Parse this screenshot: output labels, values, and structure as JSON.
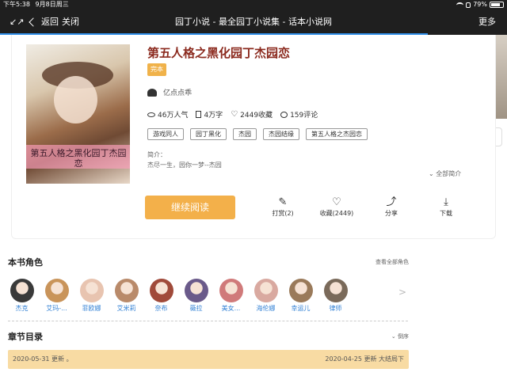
{
  "status_bar": {
    "time": "下午5:38",
    "date": "9月8日周三",
    "battery_percent": "79%",
    "battery_level": 0.79
  },
  "nav": {
    "back_label": "返回",
    "close_label": "关闭",
    "title": "园丁小说 - 最全园丁小说集 - 话本小说网",
    "more_label": "更多"
  },
  "book": {
    "cover_text": "第五人格之黑化园丁杰园恋",
    "title": "第五人格之黑化园丁杰园恋",
    "status_badge": "完本",
    "author": "亿点点乖",
    "stats": {
      "popularity": "46万人气",
      "words": "4万字",
      "favorites": "2449收藏",
      "comments": "159评论"
    },
    "tags": [
      "游戏同人",
      "园丁黑化",
      "杰园",
      "杰园结缘",
      "第五人格之杰园恋"
    ],
    "intro_label": "简介：",
    "intro_text": "杰尽一生，园你一梦--杰园",
    "full_intro_label": "全部简介"
  },
  "actions": {
    "read_button": "继续阅读",
    "tip": "打赏(2)",
    "favorite": "收藏(2449)",
    "share": "分享",
    "download": "下载"
  },
  "roles_section": {
    "title": "本书角色",
    "view_all": "查看全部角色",
    "roles": [
      {
        "name": "杰克",
        "color": "#3a3a3a"
      },
      {
        "name": "艾玛-...",
        "color": "#c9945a"
      },
      {
        "name": "菲欧娜",
        "color": "#e8c4b0"
      },
      {
        "name": "艾米莉",
        "color": "#b98a6a"
      },
      {
        "name": "奈布",
        "color": "#a04a3a"
      },
      {
        "name": "薇拉",
        "color": "#6a5a8a"
      },
      {
        "name": "美女...",
        "color": "#d07a7a"
      },
      {
        "name": "海伦娜",
        "color": "#d9a9a0"
      },
      {
        "name": "幸运儿",
        "color": "#9a7a5a"
      },
      {
        "name": "律师",
        "color": "#7a6a5a"
      }
    ]
  },
  "chapters_section": {
    "title": "章节目录",
    "order_label": "倒序",
    "updated_left": "2020-05-31 更新 。",
    "updated_right": "2020-04-25 更新 大结局下"
  }
}
